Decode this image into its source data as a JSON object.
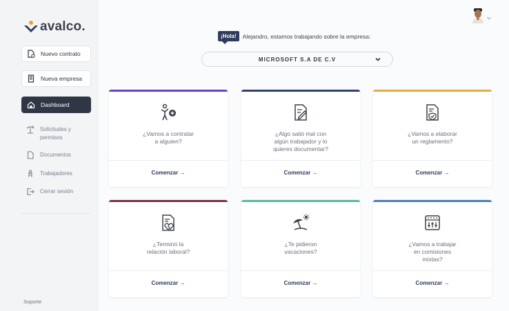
{
  "brand": {
    "name": "avalco.",
    "colors": {
      "accent": "#2f3a5c",
      "logo_orange": "#e7a52f",
      "logo_dark": "#2f3a5c"
    }
  },
  "sidebar": {
    "new_contract": "Nuevo contrato",
    "new_company": "Nueva empresa",
    "dashboard": "Dashboard",
    "items": [
      {
        "label": "Solicitudes y permisos",
        "icon": "palm-tree-icon"
      },
      {
        "label": "Documentos",
        "icon": "document-icon"
      },
      {
        "label": "Trabajadores",
        "icon": "worker-icon"
      },
      {
        "label": "Cerrar sesión",
        "icon": "logout-icon"
      }
    ],
    "support": "Soporte"
  },
  "header": {
    "hola": "¡Hola!",
    "greeting": "Alejandro, estamos trabajando sobre la empresa:",
    "company": "MICROSOFT S.A DE C.V"
  },
  "cards": [
    {
      "question": "¿Vamos a contratar a alguien?",
      "cta": "Comenzar →",
      "icon": "hire-person-icon",
      "color": "#6c3fc7"
    },
    {
      "question": "¿Algo salió mal con algún trabajador y lo quieres documentar?",
      "cta": "Comenzar →",
      "icon": "edit-document-icon",
      "color": "#2c3f6e"
    },
    {
      "question": "¿Vamos a elaborar un reglamento?",
      "cta": "Comenzar →",
      "icon": "shield-document-icon",
      "color": "#e6ac3c"
    },
    {
      "question": "¿Terminó la relación laboral?",
      "cta": "Comenzar →",
      "icon": "broken-heart-document-icon",
      "color": "#7b2f3f"
    },
    {
      "question": "¿Te pidieron vacaciones?",
      "cta": "Comenzar →",
      "icon": "beach-umbrella-icon",
      "color": "#5bb5a2"
    },
    {
      "question": "¿Vamos a trabajar en comisiones mixtas?",
      "cta": "Comenzar →",
      "icon": "calendar-mixer-icon",
      "color": "#4a7fb5"
    }
  ]
}
